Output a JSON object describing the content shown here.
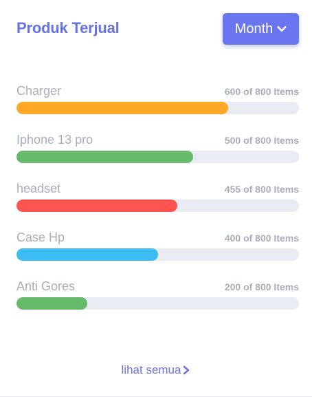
{
  "header": {
    "title": "Produk Terjual",
    "filter_label": "Month",
    "filter_icon": "chevron-down-icon"
  },
  "products": [
    {
      "name": "Charger",
      "count_text": "600 of 800 Items",
      "sold": 600,
      "total": 800,
      "color": "#ffa726"
    },
    {
      "name": "Iphone 13 pro",
      "count_text": "500 of 800 Items",
      "sold": 500,
      "total": 800,
      "color": "#66bb6a"
    },
    {
      "name": "headset",
      "count_text": "455 of 800 Items",
      "sold": 455,
      "total": 800,
      "color": "#ff5350"
    },
    {
      "name": "Case Hp",
      "count_text": "400 of 800 Items",
      "sold": 400,
      "total": 800,
      "color": "#3bbcf5"
    },
    {
      "name": "Anti Gores",
      "count_text": "200 of 800 Items",
      "sold": 200,
      "total": 800,
      "color": "#66bb6a"
    }
  ],
  "footer": {
    "link_label": "lihat semua",
    "link_icon": "chevron-right-icon"
  }
}
